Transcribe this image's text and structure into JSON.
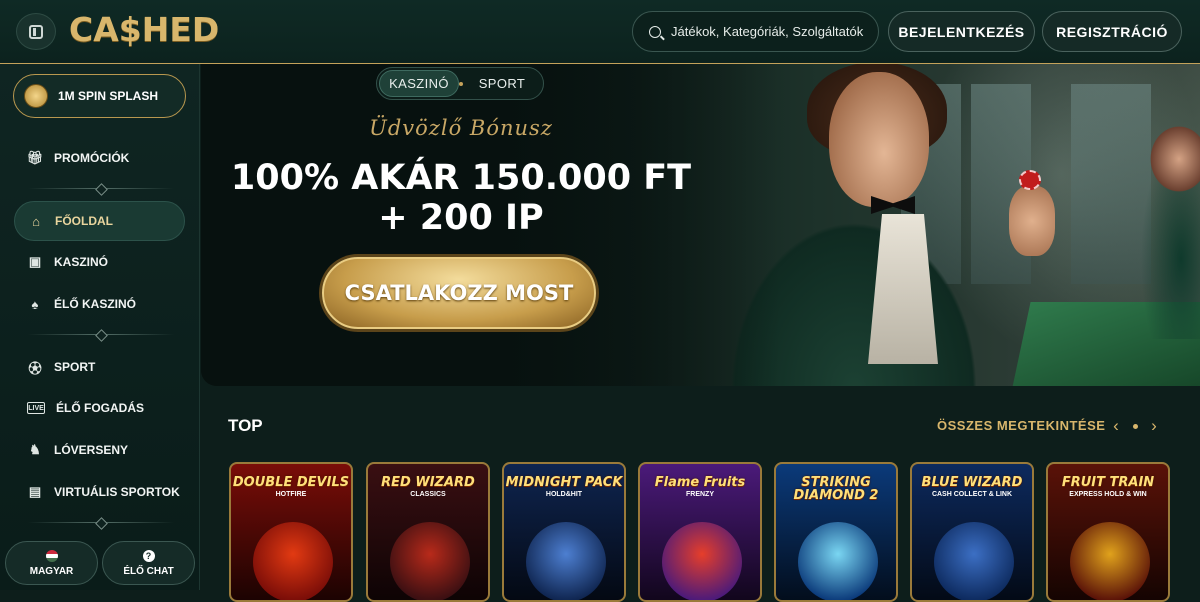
{
  "header": {
    "logo": "CA$HED",
    "search_placeholder": "Játékok, Kategóriák, Szolgáltatók",
    "login": "BEJELENTKEZÉS",
    "register": "REGISZTRÁCIÓ"
  },
  "sidebar": {
    "promo": "1M SPIN SPLASH",
    "items": [
      {
        "label": "PROMÓCIÓK",
        "icon": "gift-icon"
      },
      {
        "label": "FŐOLDAL",
        "icon": "home-icon",
        "active": true
      },
      {
        "label": "KASZINÓ",
        "icon": "slot-machine-icon"
      },
      {
        "label": "ÉLŐ KASZINÓ",
        "icon": "cards-icon"
      },
      {
        "label": "SPORT",
        "icon": "football-icon"
      },
      {
        "label": "ÉLŐ FOGADÁS",
        "icon": "live-icon"
      },
      {
        "label": "LÓVERSENY",
        "icon": "horse-icon"
      },
      {
        "label": "VIRTUÁLIS SPORTOK",
        "icon": "virtual-sports-icon"
      }
    ],
    "language": "MAGYAR",
    "chat": "ÉLŐ CHAT"
  },
  "hero": {
    "tabs": [
      "KASZINÓ",
      "SPORT"
    ],
    "active_tab": "KASZINÓ",
    "subtitle": "Üdvözlő Bónusz",
    "title_line1": "100% AKÁR 150.000 FT",
    "title_line2": "+ 200 IP",
    "cta": "CSATLAKOZZ MOST"
  },
  "top": {
    "label": "TOP",
    "see_all": "ÖSSZES MEGTEKINTÉSE",
    "games": [
      {
        "name": "DOUBLE DEVILS",
        "sub": "HOTFIRE",
        "bg": "#7a0d08",
        "art": "#e23a12"
      },
      {
        "name": "RED WIZARD",
        "sub": "CLASSICS",
        "bg": "#3a0f12",
        "art": "#b82a1a"
      },
      {
        "name": "MIDNIGHT PACK",
        "sub": "HOLD&HIT",
        "bg": "#0f2550",
        "art": "#4d7fd1"
      },
      {
        "name": "Flame Fruits",
        "sub": "FRENZY",
        "bg": "#4b1a7a",
        "art": "#e63e2a"
      },
      {
        "name": "STRIKING DIAMOND 2",
        "sub": "",
        "bg": "#0b3a7a",
        "art": "#7ad6f2"
      },
      {
        "name": "BLUE WIZARD",
        "sub": "CASH COLLECT & LINK",
        "bg": "#0d2a5e",
        "art": "#3c6fc4"
      },
      {
        "name": "FRUIT TRAIN",
        "sub": "EXPRESS HOLD & WIN",
        "bg": "#5a1208",
        "art": "#e0a21c"
      }
    ]
  },
  "colors": {
    "accent": "#d8b66c",
    "bg": "#0d1e1b"
  }
}
